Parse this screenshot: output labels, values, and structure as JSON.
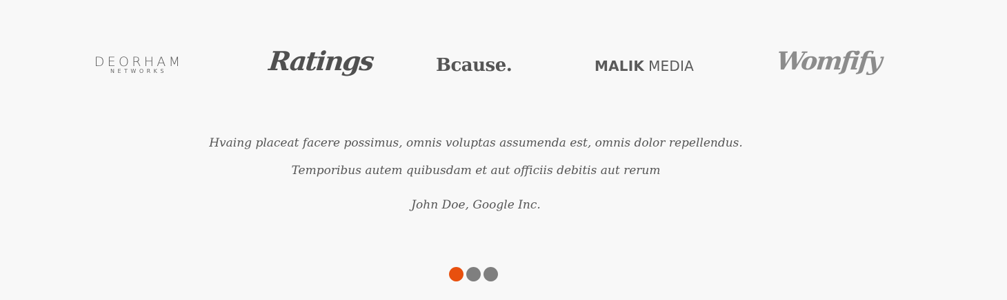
{
  "logos": {
    "deorham": {
      "main": "DEORHAM",
      "sub": "NETWORKS"
    },
    "ratings": {
      "text": "Ratings"
    },
    "bcause": {
      "text": "Bcause."
    },
    "malik": {
      "bold": "MALIK",
      "light": "MEDIA"
    },
    "womfify": {
      "text": "Womfify"
    }
  },
  "testimonial": {
    "line1": "Hvaing placeat facere possimus, omnis voluptas assumenda est, omnis dolor repellendus.",
    "line2": "Temporibus autem quibusdam et aut officiis debitis aut rerum",
    "author": "John Doe, Google Inc."
  },
  "carousel": {
    "active_index": 0,
    "count": 3
  },
  "colors": {
    "background": "#f8f8f8",
    "accent": "#e8500e",
    "dot_inactive": "#7f7f7f",
    "text": "#555555"
  }
}
